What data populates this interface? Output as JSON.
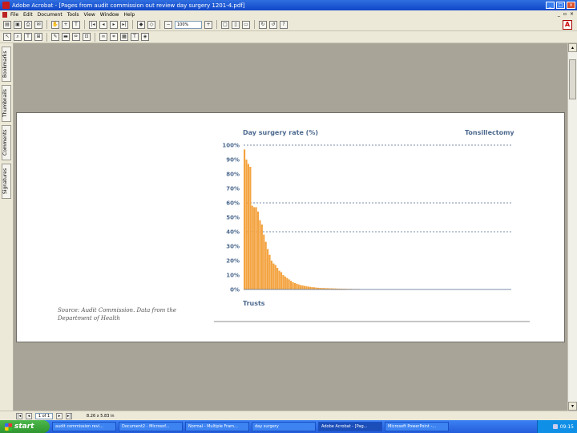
{
  "window": {
    "title": "Adobe Acrobat - [Pages from audit commission out review day surgery 1201-4.pdf]"
  },
  "menu": [
    "File",
    "Edit",
    "Document",
    "Tools",
    "View",
    "Window",
    "Help"
  ],
  "toolbar": {
    "zoom": "100%"
  },
  "nav_tabs": [
    "Bookmarks",
    "Thumbnails",
    "Comments",
    "Signatures"
  ],
  "chart_data": {
    "type": "bar",
    "title": "Day surgery rate (%)",
    "subtitle": "Tonsillectomy",
    "xlabel": "Trusts",
    "ylabel": "Day surgery rate (%)",
    "ylim": [
      0,
      100
    ],
    "yticks": [
      "0%",
      "10%",
      "20%",
      "30%",
      "40%",
      "50%",
      "60%",
      "70%",
      "80%",
      "90%",
      "100%"
    ],
    "gridlines": [
      60,
      100,
      40
    ],
    "color": "#f4a340",
    "values": [
      97,
      90,
      87,
      85,
      58,
      57,
      57,
      54,
      48,
      45,
      38,
      33,
      28,
      24,
      20,
      18,
      17,
      15,
      13,
      12,
      10,
      9,
      8,
      7,
      6,
      5,
      4.5,
      4,
      3.5,
      3,
      2.8,
      2.5,
      2.2,
      2,
      1.8,
      1.6,
      1.5,
      1.3,
      1.2,
      1.1,
      1,
      1,
      0.9,
      0.9,
      0.8,
      0.8,
      0.7,
      0.7,
      0.6,
      0.6,
      0.5,
      0.5,
      0.5,
      0.4,
      0.4,
      0.4,
      0.3,
      0.3,
      0.3,
      0.3
    ]
  },
  "source": "Source: Audit Commission. Data from the Department of Health",
  "status": {
    "page_field": "1 of 1",
    "page_size": "8.26 x 5.83 in"
  },
  "taskbar": {
    "start": "start",
    "tasks": [
      "audit commission revi...",
      "Document2 - Microsof...",
      "Normal - Multiple Fram...",
      "day surgery",
      "Adobe Acrobat - [Pag...",
      "Microsoft PowerPoint -..."
    ],
    "clock": "09:15"
  }
}
